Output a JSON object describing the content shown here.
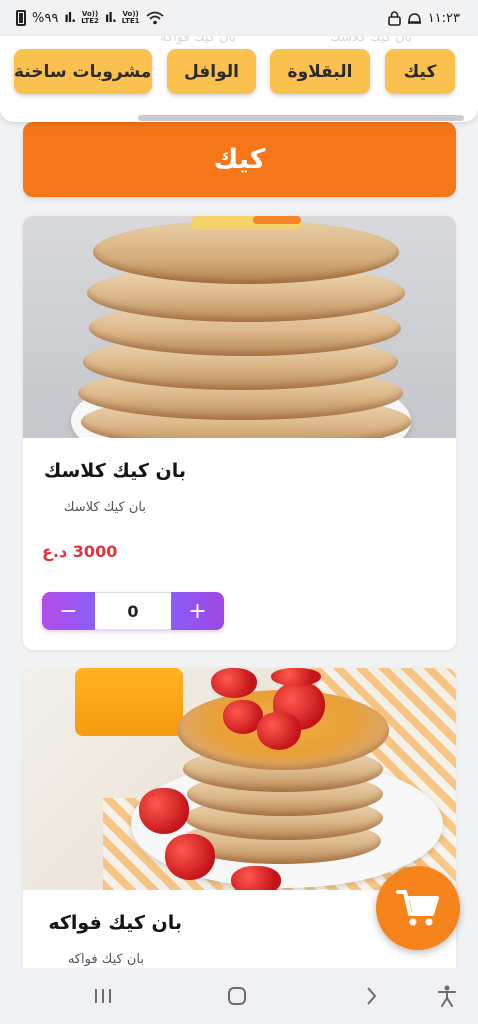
{
  "status_bar": {
    "battery": "%٩٩",
    "net_1": "Vo))\nLTE2",
    "net_2": "Vo))\nLTE1",
    "time": "١١:٢٣"
  },
  "header": {
    "ghost_left": "بان كيك فواكه",
    "ghost_right": "بان كيك كلاسك",
    "categories": [
      {
        "label": "كيك",
        "active": true
      },
      {
        "label": "البقلاوة",
        "active": false
      },
      {
        "label": "الوافل",
        "active": false
      },
      {
        "label": "مشروبات ساخنة",
        "active": false
      }
    ]
  },
  "section": {
    "title": "كيك"
  },
  "products": [
    {
      "name": "بان كيك كلاسك",
      "description": "بان كيك كلاسك",
      "price": "3000 د.ع",
      "quantity": "0",
      "minus": "−",
      "plus": "+"
    },
    {
      "name": "بان كيك فواكه",
      "description": "بان كيك فواكه"
    }
  ],
  "colors": {
    "chip": "#fbc14f",
    "section": "#f6761a",
    "price": "#e0353b",
    "stepper_start": "#b44de8",
    "stepper_end": "#8b5cf6",
    "cart": "#f6841d"
  },
  "icons": {
    "cart": "shopping-cart-icon",
    "nav_recent": "recent-apps-icon",
    "nav_home": "home-icon",
    "nav_back": "back-icon",
    "nav_accessibility": "accessibility-icon"
  }
}
